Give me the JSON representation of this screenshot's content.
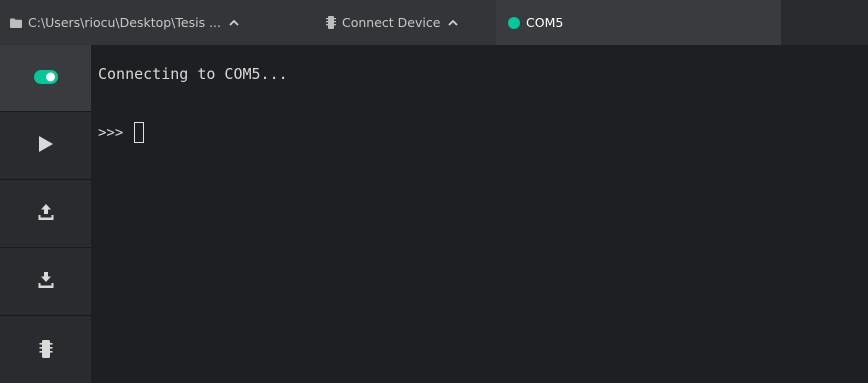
{
  "tabs": [
    {
      "icon": "folder-icon",
      "label": "C:\\Users\\riocu\\Desktop\\Tesis ...",
      "chevron": "^"
    },
    {
      "icon": "chip-icon",
      "label": "Connect Device",
      "chevron": "^"
    },
    {
      "icon": "status-dot-icon",
      "label": "COM5",
      "status_color": "#00c898"
    }
  ],
  "sidebar": {
    "items": [
      {
        "icon": "toggle-icon",
        "state": "on"
      },
      {
        "icon": "play-icon"
      },
      {
        "icon": "upload-icon"
      },
      {
        "icon": "download-icon"
      },
      {
        "icon": "chip-icon"
      }
    ]
  },
  "terminal": {
    "lines": [
      "Connecting to COM5..."
    ],
    "prompt": ">>>"
  },
  "colors": {
    "accent": "#00c898",
    "background": "#1e1f22",
    "panel": "#2a2b2e"
  }
}
